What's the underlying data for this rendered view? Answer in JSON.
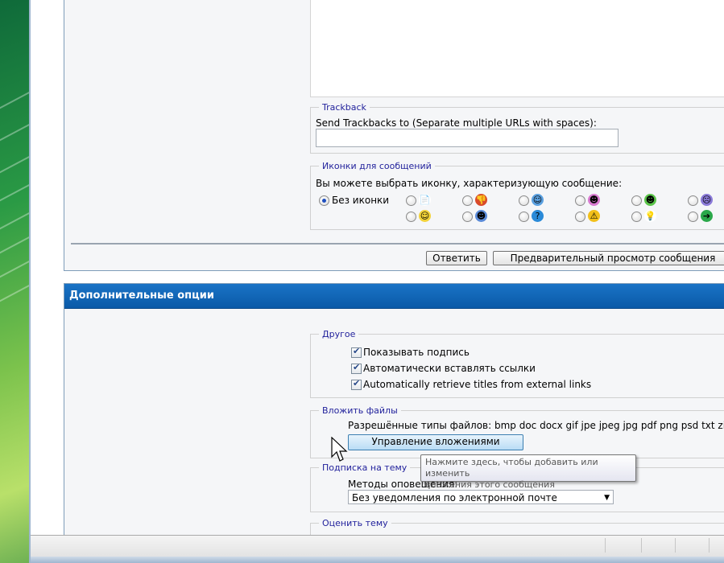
{
  "trackback": {
    "legend": "Trackback",
    "label": "Send Trackbacks to (Separate multiple URLs with spaces):",
    "input_value": ""
  },
  "post_icons": {
    "legend": "Иконки для сообщений",
    "label": "Вы можете выбрать иконку, характеризующую сообщение:",
    "no_icon_label": "Без иконки",
    "selected": "none",
    "icons": [
      {
        "name": "note-icon",
        "glyph": "📄",
        "color": "#ffffff"
      },
      {
        "name": "thumbs-down-icon",
        "glyph": "👎",
        "color": "#d94a2a"
      },
      {
        "name": "wink-smiley-icon",
        "glyph": "☺",
        "color": "#5aa0e0"
      },
      {
        "name": "grin-smiley-icon",
        "glyph": "☻",
        "color": "#d87ad0"
      },
      {
        "name": "big-grin-smiley-icon",
        "glyph": "☻",
        "color": "#5bc44a"
      },
      {
        "name": "angry-smiley-icon",
        "glyph": "☹",
        "color": "#8a7ad8"
      },
      {
        "name": "smile-smiley-icon",
        "glyph": "☺",
        "color": "#f2d23a"
      },
      {
        "name": "cool-smiley-icon",
        "glyph": "☻",
        "color": "#5a8ad8"
      },
      {
        "name": "question-icon",
        "glyph": "?",
        "color": "#2a8ad8"
      },
      {
        "name": "warning-icon",
        "glyph": "⚠",
        "color": "#f2c01a"
      },
      {
        "name": "lightbulb-icon",
        "glyph": "💡",
        "color": "#ffffff"
      },
      {
        "name": "arrow-right-icon",
        "glyph": "➔",
        "color": "#2aa84a"
      }
    ]
  },
  "actions": {
    "reply_label": "Ответить",
    "preview_label": "Предварительный просмотр сообщения"
  },
  "options": {
    "header": "Дополнительные опции",
    "misc": {
      "legend": "Другое",
      "items": [
        {
          "label": "Показывать подпись",
          "checked": true
        },
        {
          "label": "Автоматически вставлять ссылки",
          "checked": true
        },
        {
          "label": "Automatically retrieve titles from external links",
          "checked": true
        }
      ]
    },
    "attach": {
      "legend": "Вложить файлы",
      "allowed_label": "Разрешённые типы файлов: bmp doc docx gif jpe jpeg jpg pdf png psd txt zip",
      "manage_button": "Управление вложениями",
      "tooltip_line1": "Нажмите здесь, чтобы добавить или изменить",
      "tooltip_line2": "вложения этого сообщения"
    },
    "subscribe": {
      "legend": "Подписка на тему",
      "method_label": "Методы оповещения:",
      "selected_option": "Без уведомления по электронной почте"
    },
    "rate": {
      "legend": "Оценить тему"
    }
  }
}
